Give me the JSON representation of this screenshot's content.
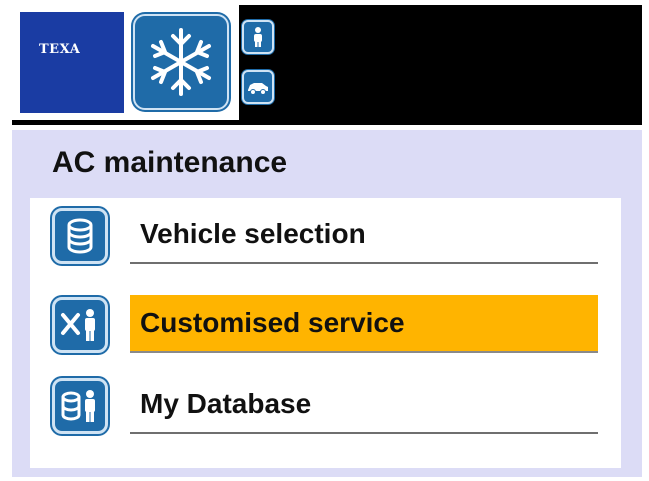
{
  "header": {
    "logo_text": "TEXA",
    "main_icon": "snowflake-icon",
    "side_icons": [
      "person-icon",
      "car-icon"
    ]
  },
  "panel": {
    "title": "AC maintenance"
  },
  "menu": {
    "items": [
      {
        "label": "Vehicle selection",
        "icon": "database-icon",
        "selected": false
      },
      {
        "label": "Customised service",
        "icon": "tools-person-icon",
        "selected": true
      },
      {
        "label": "My Database",
        "icon": "database-person-icon",
        "selected": false
      }
    ]
  },
  "colors": {
    "header_bg": "#000000",
    "brand_blue": "#1a3ca3",
    "icon_blue": "#1f6ba8",
    "panel_bg": "#dcdcf6",
    "highlight": "#ffb400"
  }
}
